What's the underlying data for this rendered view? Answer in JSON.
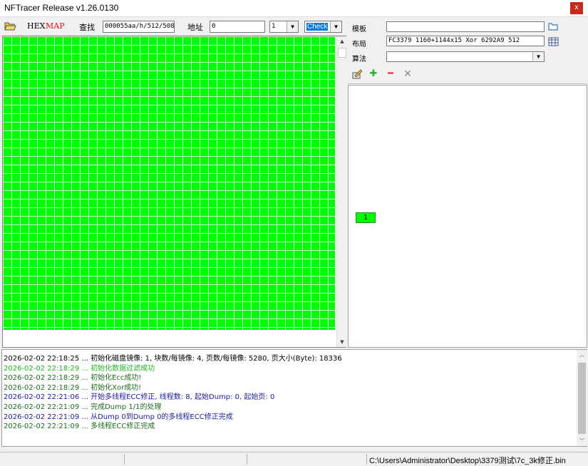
{
  "window": {
    "title": "NFTracer Release v1.26.0130",
    "close_label": "x"
  },
  "toolbar": {
    "hex_label": "HEX",
    "map_label": "MAP",
    "search_label": "查找",
    "search_value": "000055aa/h/512/508",
    "address_label": "地址",
    "address_value": "0",
    "count_value": "1",
    "check_value": "Check"
  },
  "right_panel": {
    "template_label": "模板",
    "template_value": "",
    "layout_label": "布局",
    "layout_value": "FC3379 1160+1144x15 Xor 6292A9 512",
    "algorithm_label": "算法",
    "algorithm_value": "",
    "node_label": "1"
  },
  "log": [
    {
      "text": "2026-02-02 22:18:25 ... 初始化磁盘镜像: 1, 块数/每镜像: 4, 页数/每镜像: 5280, 页大小(Byte): 18336",
      "color": "#000000"
    },
    {
      "text": "2026-02-02 22:18:29 ... 初始化数据过滤成功",
      "color": "#22b422"
    },
    {
      "text": "2026-02-02 22:18:29 ... 初始化Ecc成功!",
      "color": "#1f6b1f"
    },
    {
      "text": "2026-02-02 22:18:29 ... 初始化Xor成功!",
      "color": "#1f6b1f"
    },
    {
      "text": "2026-02-02 22:21:06 ... 开始多线程ECC修正, 线程数: 8, 起始Dump: 0, 起始页: 0",
      "color": "#1a1a9c"
    },
    {
      "text": "2026-02-02 22:21:09 ... 完成Dump 1/1的处理",
      "color": "#1f6b1f"
    },
    {
      "text": "2026-02-02 22:21:09 ... 从Dump 0到Dump 0的多线程ECC修正完成",
      "color": "#1a1a9c"
    },
    {
      "text": "2026-02-02 22:21:09 ... 多线程ECC修正完成",
      "color": "#1f6b1f"
    }
  ],
  "status": {
    "path": "C:\\Users\\Administrator\\Desktop\\3379测试\\7c_3k修正.bin"
  },
  "colors": {
    "map_cell": "#00ff00",
    "map_label": "#e01010"
  }
}
